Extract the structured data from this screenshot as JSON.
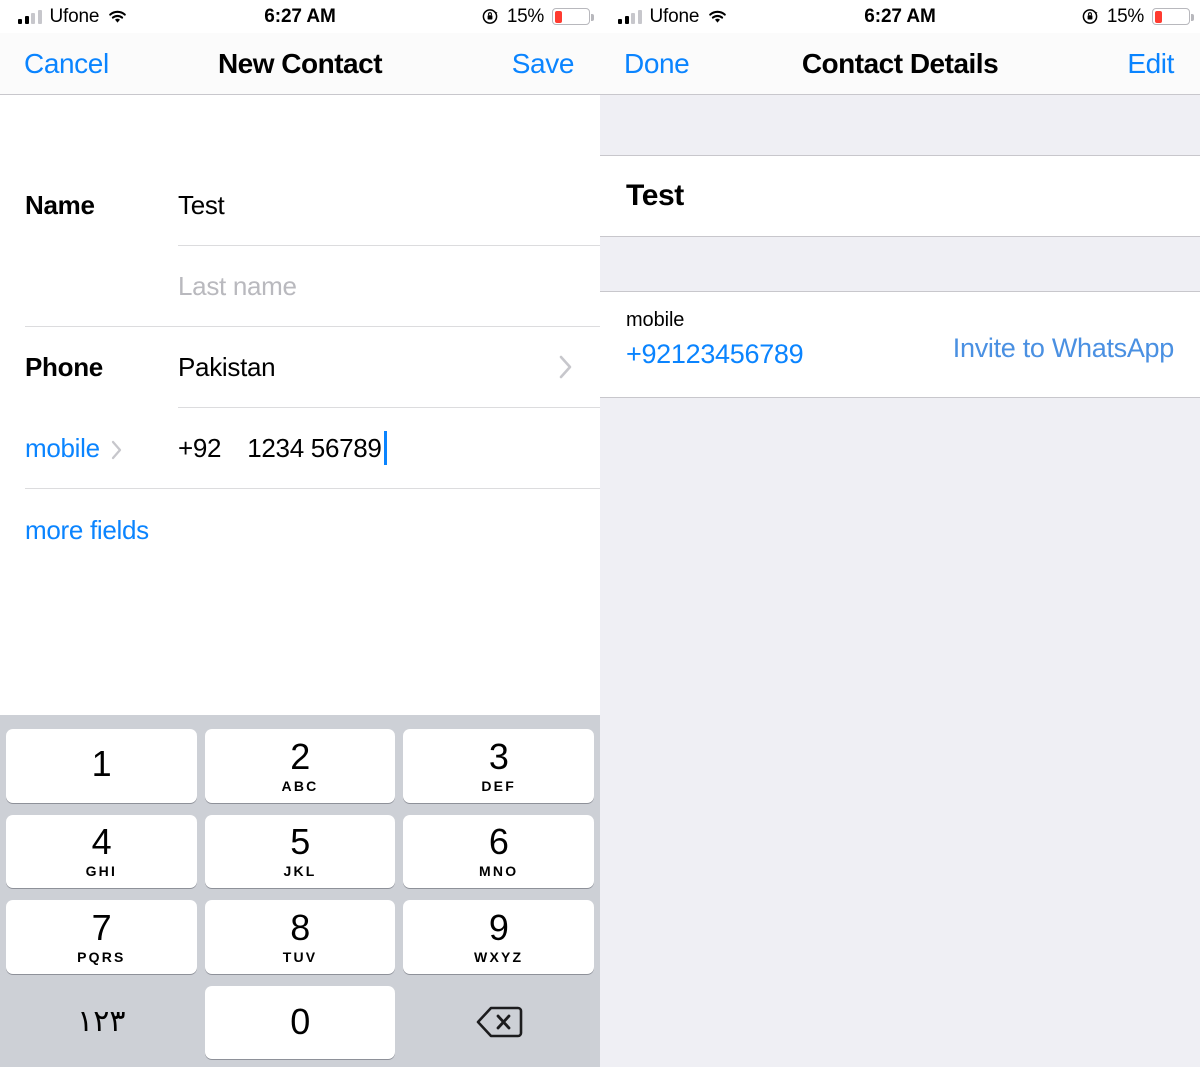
{
  "status_bar": {
    "carrier": "Ufone",
    "time": "6:27 AM",
    "battery_percent": "15%",
    "battery_level": 15,
    "signal_bars_filled": 2,
    "signal_bars_total": 4,
    "icons": [
      "signal-bars-icon",
      "wifi-icon",
      "rotation-lock-icon",
      "battery-icon"
    ]
  },
  "left_screen": {
    "nav": {
      "cancel_label": "Cancel",
      "title": "New Contact",
      "save_label": "Save"
    },
    "name_section": {
      "label": "Name",
      "first_name_value": "Test",
      "last_name_placeholder": "Last name"
    },
    "phone_section": {
      "label": "Phone",
      "country_value": "Pakistan",
      "type_label": "mobile",
      "country_code": "+92",
      "number_value": "1234 56789"
    },
    "more_fields_label": "more fields",
    "keypad": {
      "keys": [
        {
          "num": "1",
          "sub": ""
        },
        {
          "num": "2",
          "sub": "ABC"
        },
        {
          "num": "3",
          "sub": "DEF"
        },
        {
          "num": "4",
          "sub": "GHI"
        },
        {
          "num": "5",
          "sub": "JKL"
        },
        {
          "num": "6",
          "sub": "MNO"
        },
        {
          "num": "7",
          "sub": "PQRS"
        },
        {
          "num": "8",
          "sub": "TUV"
        },
        {
          "num": "9",
          "sub": "WXYZ"
        }
      ],
      "numeral_toggle_label": "١٢٣",
      "zero_label": "0",
      "delete_icon": "backspace-icon"
    }
  },
  "right_screen": {
    "nav": {
      "done_label": "Done",
      "title": "Contact Details",
      "edit_label": "Edit"
    },
    "contact_name": "Test",
    "phone_row": {
      "type_label": "mobile",
      "number": "+92123456789",
      "action_label": "Invite to WhatsApp"
    }
  },
  "colors": {
    "accent_blue": "#0a84ff",
    "invite_blue": "#4a90e2",
    "battery_red": "#ff3b30",
    "panel_bg": "#EFEFF4",
    "keyboard_bg": "#cdd0d6",
    "separator": "#c8c7cc"
  }
}
